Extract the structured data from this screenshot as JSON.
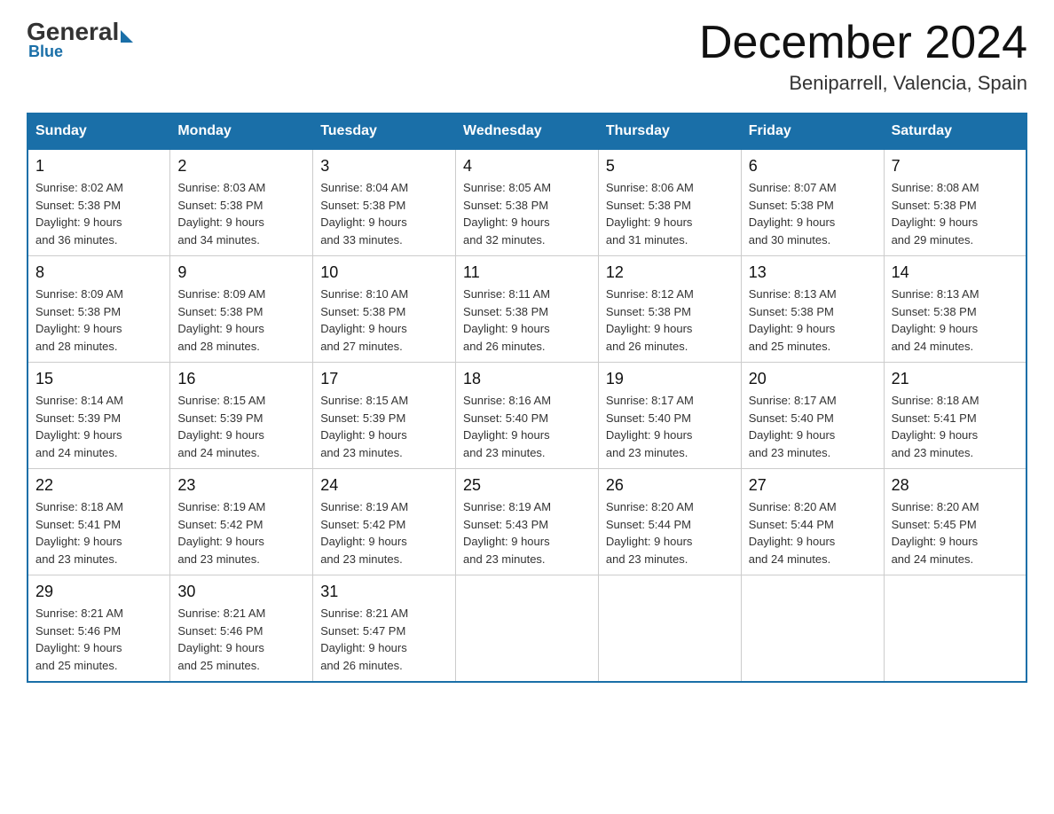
{
  "header": {
    "logo_general": "General",
    "logo_blue": "Blue",
    "title": "December 2024",
    "subtitle": "Beniparrell, Valencia, Spain"
  },
  "days_of_week": [
    "Sunday",
    "Monday",
    "Tuesday",
    "Wednesday",
    "Thursday",
    "Friday",
    "Saturday"
  ],
  "weeks": [
    [
      {
        "day": "1",
        "sunrise": "8:02 AM",
        "sunset": "5:38 PM",
        "daylight": "9 hours and 36 minutes."
      },
      {
        "day": "2",
        "sunrise": "8:03 AM",
        "sunset": "5:38 PM",
        "daylight": "9 hours and 34 minutes."
      },
      {
        "day": "3",
        "sunrise": "8:04 AM",
        "sunset": "5:38 PM",
        "daylight": "9 hours and 33 minutes."
      },
      {
        "day": "4",
        "sunrise": "8:05 AM",
        "sunset": "5:38 PM",
        "daylight": "9 hours and 32 minutes."
      },
      {
        "day": "5",
        "sunrise": "8:06 AM",
        "sunset": "5:38 PM",
        "daylight": "9 hours and 31 minutes."
      },
      {
        "day": "6",
        "sunrise": "8:07 AM",
        "sunset": "5:38 PM",
        "daylight": "9 hours and 30 minutes."
      },
      {
        "day": "7",
        "sunrise": "8:08 AM",
        "sunset": "5:38 PM",
        "daylight": "9 hours and 29 minutes."
      }
    ],
    [
      {
        "day": "8",
        "sunrise": "8:09 AM",
        "sunset": "5:38 PM",
        "daylight": "9 hours and 28 minutes."
      },
      {
        "day": "9",
        "sunrise": "8:09 AM",
        "sunset": "5:38 PM",
        "daylight": "9 hours and 28 minutes."
      },
      {
        "day": "10",
        "sunrise": "8:10 AM",
        "sunset": "5:38 PM",
        "daylight": "9 hours and 27 minutes."
      },
      {
        "day": "11",
        "sunrise": "8:11 AM",
        "sunset": "5:38 PM",
        "daylight": "9 hours and 26 minutes."
      },
      {
        "day": "12",
        "sunrise": "8:12 AM",
        "sunset": "5:38 PM",
        "daylight": "9 hours and 26 minutes."
      },
      {
        "day": "13",
        "sunrise": "8:13 AM",
        "sunset": "5:38 PM",
        "daylight": "9 hours and 25 minutes."
      },
      {
        "day": "14",
        "sunrise": "8:13 AM",
        "sunset": "5:38 PM",
        "daylight": "9 hours and 24 minutes."
      }
    ],
    [
      {
        "day": "15",
        "sunrise": "8:14 AM",
        "sunset": "5:39 PM",
        "daylight": "9 hours and 24 minutes."
      },
      {
        "day": "16",
        "sunrise": "8:15 AM",
        "sunset": "5:39 PM",
        "daylight": "9 hours and 24 minutes."
      },
      {
        "day": "17",
        "sunrise": "8:15 AM",
        "sunset": "5:39 PM",
        "daylight": "9 hours and 23 minutes."
      },
      {
        "day": "18",
        "sunrise": "8:16 AM",
        "sunset": "5:40 PM",
        "daylight": "9 hours and 23 minutes."
      },
      {
        "day": "19",
        "sunrise": "8:17 AM",
        "sunset": "5:40 PM",
        "daylight": "9 hours and 23 minutes."
      },
      {
        "day": "20",
        "sunrise": "8:17 AM",
        "sunset": "5:40 PM",
        "daylight": "9 hours and 23 minutes."
      },
      {
        "day": "21",
        "sunrise": "8:18 AM",
        "sunset": "5:41 PM",
        "daylight": "9 hours and 23 minutes."
      }
    ],
    [
      {
        "day": "22",
        "sunrise": "8:18 AM",
        "sunset": "5:41 PM",
        "daylight": "9 hours and 23 minutes."
      },
      {
        "day": "23",
        "sunrise": "8:19 AM",
        "sunset": "5:42 PM",
        "daylight": "9 hours and 23 minutes."
      },
      {
        "day": "24",
        "sunrise": "8:19 AM",
        "sunset": "5:42 PM",
        "daylight": "9 hours and 23 minutes."
      },
      {
        "day": "25",
        "sunrise": "8:19 AM",
        "sunset": "5:43 PM",
        "daylight": "9 hours and 23 minutes."
      },
      {
        "day": "26",
        "sunrise": "8:20 AM",
        "sunset": "5:44 PM",
        "daylight": "9 hours and 23 minutes."
      },
      {
        "day": "27",
        "sunrise": "8:20 AM",
        "sunset": "5:44 PM",
        "daylight": "9 hours and 24 minutes."
      },
      {
        "day": "28",
        "sunrise": "8:20 AM",
        "sunset": "5:45 PM",
        "daylight": "9 hours and 24 minutes."
      }
    ],
    [
      {
        "day": "29",
        "sunrise": "8:21 AM",
        "sunset": "5:46 PM",
        "daylight": "9 hours and 25 minutes."
      },
      {
        "day": "30",
        "sunrise": "8:21 AM",
        "sunset": "5:46 PM",
        "daylight": "9 hours and 25 minutes."
      },
      {
        "day": "31",
        "sunrise": "8:21 AM",
        "sunset": "5:47 PM",
        "daylight": "9 hours and 26 minutes."
      },
      null,
      null,
      null,
      null
    ]
  ],
  "labels": {
    "sunrise": "Sunrise:",
    "sunset": "Sunset:",
    "daylight": "Daylight:"
  }
}
